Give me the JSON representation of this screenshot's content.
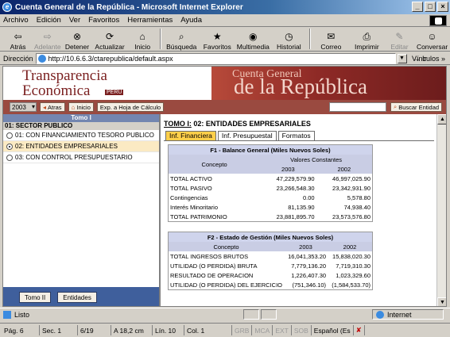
{
  "window": {
    "title": "Cuenta General de la República - Microsoft Internet Explorer"
  },
  "menu": [
    "Archivo",
    "Edición",
    "Ver",
    "Favoritos",
    "Herramientas",
    "Ayuda"
  ],
  "toolbar": {
    "atras": "Atrás",
    "adelante": "Adelante",
    "detener": "Detener",
    "actualizar": "Actualizar",
    "inicio": "Inicio",
    "busqueda": "Búsqueda",
    "favoritos": "Favoritos",
    "multimedia": "Multimedia",
    "historial": "Historial",
    "correo": "Correo",
    "imprimir": "Imprimir",
    "editar": "Editar",
    "conversar": "Conversar"
  },
  "address": {
    "label": "Dirección",
    "url": "http://10.6.6.3/ctarepublica/default.aspx",
    "ir": "Ir",
    "vinculos": "Vínculos"
  },
  "banner": {
    "logo_line1": "Transparencia",
    "logo_line2": "Económica",
    "logo_tag": "PERU",
    "cuenta_general": "Cuenta General",
    "de_la_republica": "de la República"
  },
  "nav": {
    "year": "2003",
    "atras": "Atras",
    "inicio": "Inicio",
    "export": "Exp. a Hoja de Cálculo",
    "buscar": "Buscar Entidad"
  },
  "left": {
    "tomo_header": "Tomo I",
    "sector": "01: SECTOR PUBLICO",
    "options": [
      {
        "label": "01: CON FINANCIAMIENTO TESORO PUBLICO",
        "selected": false
      },
      {
        "label": "02: ENTIDADES EMPRESARIALES",
        "selected": true
      },
      {
        "label": "03: CON CONTROL PRESUPUESTARIO",
        "selected": false
      }
    ],
    "btn_tomo2": "Tomo II",
    "btn_entidades": "Entidades"
  },
  "right": {
    "tomo_label": "TOMO I:",
    "tomo_title": "02: ENTIDADES EMPRESARIALES",
    "tabs": [
      "Inf. Financiera",
      "Inf. Presupuestal",
      "Formatos"
    ],
    "active_tab": 0,
    "f1": {
      "title": "F1 - Balance General (Miles Nuevos Soles)",
      "col_concepto": "Concepto",
      "col_valores": "Valores Constantes",
      "years": [
        "2003",
        "2002"
      ],
      "rows": [
        {
          "concepto": "TOTAL ACTIVO",
          "v2003": "47,229,579.90",
          "v2002": "46,997,025.90"
        },
        {
          "concepto": "TOTAL PASIVO",
          "v2003": "23,266,548.30",
          "v2002": "23,342,931.90"
        },
        {
          "concepto": "Contingencias",
          "v2003": "0.00",
          "v2002": "5,578.80"
        },
        {
          "concepto": "Interés Minoritario",
          "v2003": "81,135.90",
          "v2002": "74,938.40"
        },
        {
          "concepto": "TOTAL PATRIMONIO",
          "v2003": "23,881,895.70",
          "v2002": "23,573,576.80"
        }
      ]
    },
    "f2": {
      "title": "F2 - Estado de Gestión (Miles Nuevos Soles)",
      "col_concepto": "Concepto",
      "years": [
        "2003",
        "2002"
      ],
      "rows": [
        {
          "concepto": "TOTAL INGRESOS BRUTOS",
          "v2003": "16,041,353.20",
          "v2002": "15,838,020.30"
        },
        {
          "concepto": "UTILIDAD (O PERDIDA) BRUTA",
          "v2003": "7,779,136.20",
          "v2002": "7,719,310.30"
        },
        {
          "concepto": "RESULTADO DE OPERACION",
          "v2003": "1,226,407.30",
          "v2002": "1,023,329.60"
        },
        {
          "concepto": "UTILIDAD (O PERDIDA) DEL EJERCICIO",
          "v2003": "(751,346.10)",
          "v2002": "(1,584,533.70)"
        }
      ]
    }
  },
  "status": {
    "text": "Listo",
    "zone": "Internet"
  },
  "wordbar": {
    "pag": "Pág. 6",
    "sec": "Sec. 1",
    "pages": "6/19",
    "pos": "A 18,2 cm",
    "lin": "Lín. 10",
    "col": "Col. 1",
    "grb": "GRB",
    "mca": "MCA",
    "ext": "EXT",
    "sob": "SOB",
    "lang": "Español (Es"
  },
  "colors": {
    "titlebar": "#0a246a",
    "brand": "#7a1f1f",
    "active_tab": "#ffcf4a",
    "table_header": "#cfd4ec"
  }
}
